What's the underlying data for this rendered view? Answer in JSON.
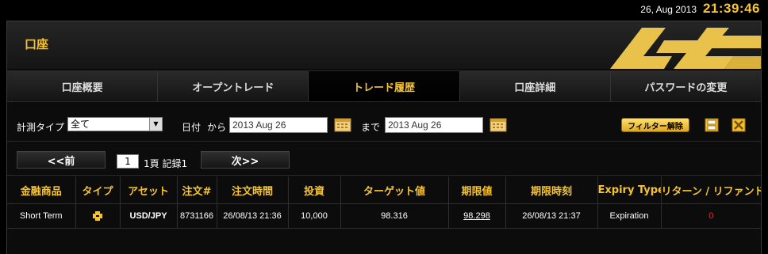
{
  "top": {
    "date": "26, Aug 2013",
    "time": "21:39:46"
  },
  "header": {
    "title": "口座"
  },
  "tabs": [
    "口座概要",
    "オープントレード",
    "トレード履歴",
    "口座詳細",
    "パスワードの変更"
  ],
  "filters": {
    "type_label": "計測タイプ",
    "type_value": "全て",
    "date_label": "日付",
    "from_label": "から",
    "from_value": "2013 Aug 26",
    "to_label": "まで",
    "to_value": "2013 Aug 26",
    "clear_label": "フィルター解除"
  },
  "pager": {
    "prev_label": "<<前",
    "page_value": "1",
    "page_text": "1頁 記録1",
    "next_label": "次>>"
  },
  "table": {
    "headers": [
      "金融商品",
      "タイプ",
      "アセット",
      "注文#",
      "注文時間",
      "投資",
      "ターゲット値",
      "期限値",
      "期限時刻",
      "Expiry Type",
      "リターン / リファンド"
    ],
    "rows": [
      [
        "Short Term",
        "",
        "USD/JPY",
        "8731166",
        "26/08/13 21:36",
        "10,000",
        "98.316",
        "98.298",
        "26/08/13 21:37",
        "Expiration",
        "0"
      ]
    ]
  },
  "colors": {
    "accent": "#f6c431",
    "background": "#000000",
    "loss": "#e23030"
  }
}
